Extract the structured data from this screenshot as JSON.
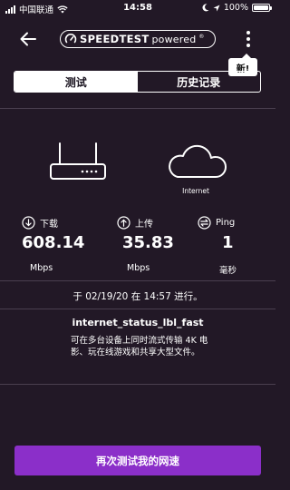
{
  "status_bar": {
    "carrier": "中国联通",
    "time": "14:58",
    "battery_percent": "100%",
    "battery_level": 1.0,
    "icons": [
      "signal-icon",
      "wifi-icon",
      "moon-icon",
      "location-icon",
      "battery-icon"
    ]
  },
  "header": {
    "logo_bold": "SPEEDTEST",
    "logo_light": "powered",
    "logo_mark": "®",
    "new_badge": "新!"
  },
  "tabs": [
    {
      "label": "测试",
      "active": true
    },
    {
      "label": "历史记录",
      "active": false
    }
  ],
  "diagram": {
    "internet_label": "Internet"
  },
  "metrics": {
    "download": {
      "label": "下载",
      "value": "608.14",
      "unit": "Mbps"
    },
    "upload": {
      "label": "上传",
      "value": "35.83",
      "unit": "Mbps"
    },
    "ping": {
      "label": "Ping",
      "value": "1",
      "unit": "毫秒"
    }
  },
  "result": {
    "test_date": "于 02/19/20 在 14:57 进行。",
    "status_title": "internet_status_lbl_fast",
    "status_desc": "可在多台设备上同时流式传输 4K 电影、玩在线游戏和共享大型文件。"
  },
  "retest_button": "再次测试我的网速",
  "colors": {
    "background": "#221826",
    "accent": "#8b2fc9",
    "divider": "#4a3f4f"
  }
}
